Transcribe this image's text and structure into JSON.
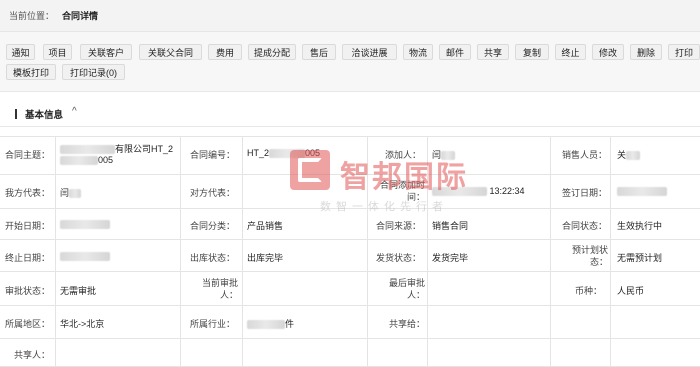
{
  "breadcrumb": {
    "label": "当前位置：",
    "current": "合同详情"
  },
  "toolbar": {
    "row1": [
      "通知",
      "项目",
      "关联客户",
      "关联父合同",
      "费用",
      "提成分配",
      "售后",
      "洽谈进展",
      "物流",
      "邮件",
      "共享",
      "复制",
      "终止",
      "修改",
      "删除",
      "打印"
    ],
    "row2": [
      "模板打印",
      "打印记录(0)"
    ]
  },
  "section": {
    "title": "基本信息",
    "chevron": "^"
  },
  "watermark": {
    "name": "智邦国际",
    "slogan": "数智一体化先行者"
  },
  "fields": {
    "subject_label": "合同主题：",
    "subject_value_a": "有限公司HT_2",
    "subject_value_b": "005",
    "contract_no_label": "合同编号：",
    "contract_no_value_a": "HT_2",
    "contract_no_value_b": "005",
    "adder_label": "添加人：",
    "adder_value": "闫",
    "sales_label": "销售人员：",
    "sales_value": "关",
    "our_rep_label": "我方代表：",
    "our_rep_value": "闫",
    "their_rep_label": "对方代表：",
    "their_rep_value": "",
    "add_time_label_a": "合同添加时",
    "add_time_label_b": "间：",
    "add_time_value": "13:22:34",
    "sign_date_label": "签订日期：",
    "sign_date_value": "",
    "start_date_label": "开始日期：",
    "start_date_value": "",
    "category_label": "合同分类：",
    "category_value": "产品销售",
    "source_label": "合同来源：",
    "source_value": "销售合同",
    "status_label": "合同状态：",
    "status_value": "生效执行中",
    "end_date_label": "终止日期：",
    "end_date_value": "",
    "outbound_label": "出库状态：",
    "outbound_value": "出库完毕",
    "shipping_label": "发货状态：",
    "shipping_value": "发货完毕",
    "plan_label_a": "预计划状",
    "plan_label_b": "态：",
    "plan_value": "无需预计划",
    "approval_label": "审批状态：",
    "approval_value": "无需审批",
    "cur_approver_label_a": "当前审批",
    "cur_approver_label_b": "人：",
    "cur_approver_value": "",
    "last_approver_label_a": "最后审批",
    "last_approver_label_b": "人：",
    "last_approver_value": "",
    "currency_label": "币种：",
    "currency_value": "人民币",
    "region_label": "所属地区：",
    "region_value": "华北->北京",
    "industry_label": "所属行业：",
    "industry_value": "件",
    "share_to_label": "共享给：",
    "share_to_value": "",
    "sharer_label": "共享人：",
    "sharer_value": ""
  }
}
